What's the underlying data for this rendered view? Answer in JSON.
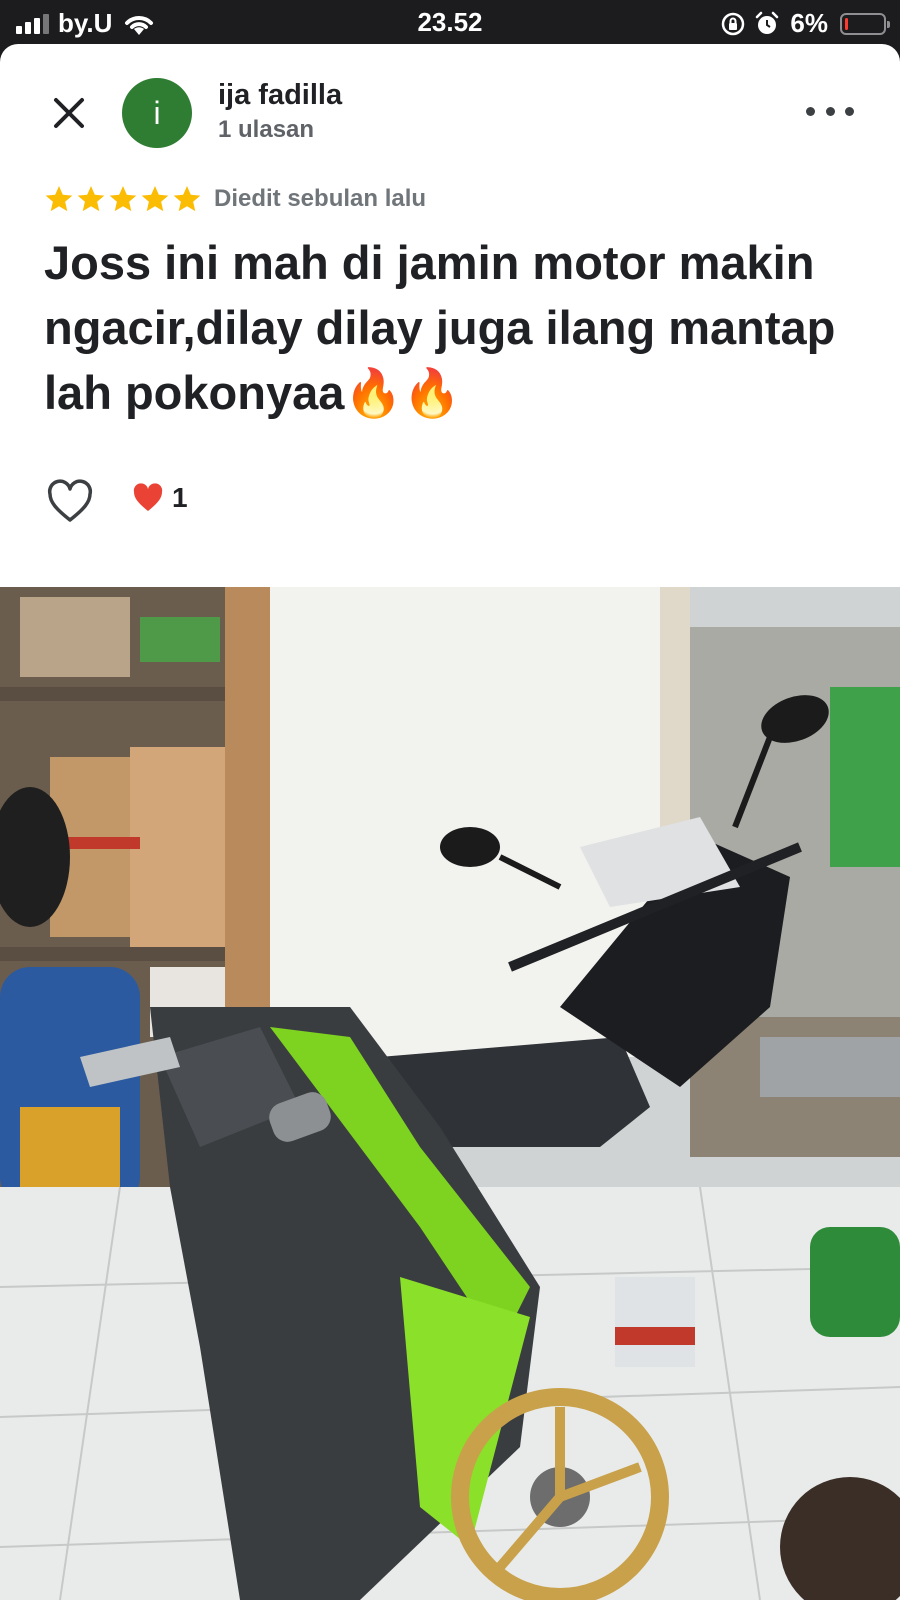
{
  "status_bar": {
    "carrier": "by.U",
    "time": "23.52",
    "battery_percent": "6%",
    "battery_level": 0.06,
    "icons": [
      "signal-icon",
      "wifi-icon",
      "orientation-lock-icon",
      "alarm-icon",
      "battery-icon"
    ]
  },
  "review": {
    "reviewer_initial": "i",
    "reviewer_name": "ija fadilla",
    "reviewer_review_count": "1 ulasan",
    "rating": 5,
    "rating_max": 5,
    "edited_label": "Diedit sebulan lalu",
    "text": "Joss ini mah di jamin motor makin ngacir,dilay dilay juga ilang mantap lah pokonyaa🔥🔥",
    "like_count": "1"
  },
  "colors": {
    "avatar": "#2e7d32",
    "star": "#fbbc04",
    "heart": "#ea4335"
  },
  "photo": {
    "description_icon": "review-photo-motorcycle"
  }
}
